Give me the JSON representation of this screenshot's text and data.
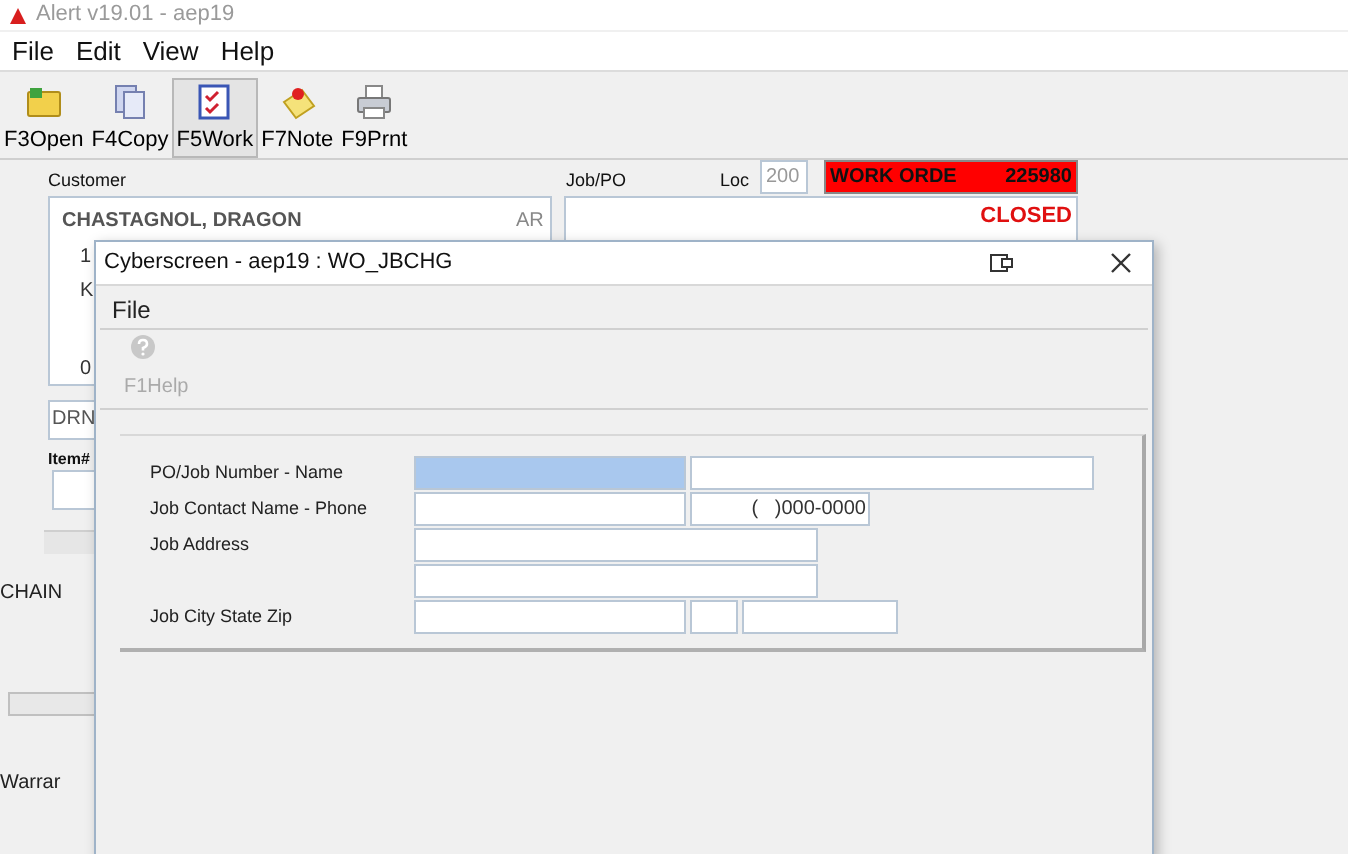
{
  "window": {
    "title": "Alert v19.01 - aep19"
  },
  "menu": [
    "File",
    "Edit",
    "View",
    "Help"
  ],
  "toolbar": [
    {
      "label": "F3Open",
      "kind": "open",
      "selected": false
    },
    {
      "label": "F4Copy",
      "kind": "copy",
      "selected": false
    },
    {
      "label": "F5Work",
      "kind": "work",
      "selected": true
    },
    {
      "label": "F7Note",
      "kind": "note",
      "selected": false
    },
    {
      "label": "F9Prnt",
      "kind": "print",
      "selected": false
    }
  ],
  "customer": {
    "label": "Customer",
    "name": "CHASTAGNOL, DRAGON",
    "code": "AR",
    "lines": [
      "1",
      "K",
      "0"
    ],
    "field": "DRN"
  },
  "job_po": {
    "label": "Job/PO",
    "loc_label": "Loc",
    "loc_value": "200",
    "order_label": "WORK ORDE",
    "order_number": "225980",
    "status": "CLOSED"
  },
  "items": {
    "label": "Item#",
    "row_text": "CHAIN",
    "footer": "Warrar"
  },
  "dialog": {
    "title": "Cyberscreen - aep19 : WO_JBCHG",
    "menu": [
      "File"
    ],
    "toolbar": [
      {
        "label": "F1Help",
        "disabled": true
      }
    ],
    "form": [
      {
        "label": "PO/Job Number - Name",
        "fields": [
          {
            "focused": true
          },
          {
            "focused": false
          }
        ]
      },
      {
        "label": "Job Contact Name - Phone",
        "fields": [
          {
            "focused": false
          },
          {
            "value": "(   )000-0000",
            "focused": false
          }
        ]
      },
      {
        "label": "Job Address",
        "fields": [
          {
            "focused": false
          }
        ]
      },
      {
        "fields": [
          {
            "focused": false
          }
        ]
      },
      {
        "label": "Job City State Zip",
        "fields": [
          {
            "focused": false
          },
          {
            "focused": false
          },
          {
            "focused": false
          }
        ]
      }
    ]
  }
}
